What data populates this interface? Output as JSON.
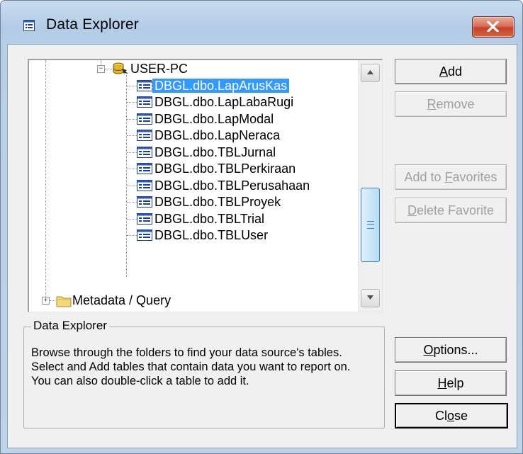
{
  "window": {
    "title": "Data Explorer",
    "close_icon": "close-x-icon",
    "app_icon": "data-explorer-icon"
  },
  "tree": {
    "server": "USER-PC",
    "tables": [
      "DBGL.dbo.LapArusKas",
      "DBGL.dbo.LapLabaRugi",
      "DBGL.dbo.LapModal",
      "DBGL.dbo.LapNeraca",
      "DBGL.dbo.TBLJurnal",
      "DBGL.dbo.TBLPerkiraan",
      "DBGL.dbo.TBLPerusahaan",
      "DBGL.dbo.TBLProyek",
      "DBGL.dbo.TBLTrial",
      "DBGL.dbo.TBLUser"
    ],
    "selected_index": 0,
    "folder": "Metadata / Query"
  },
  "buttons": {
    "add": {
      "pre": "",
      "key": "A",
      "post": "dd"
    },
    "remove": {
      "pre": "",
      "key": "R",
      "post": "emove"
    },
    "add_favorites": {
      "pre": "Add to ",
      "key": "F",
      "post": "avorites"
    },
    "delete_favorite": {
      "pre": "",
      "key": "D",
      "post": "elete Favorite"
    },
    "options": {
      "pre": "",
      "key": "O",
      "post": "ptions..."
    },
    "help": {
      "pre": "",
      "key": "H",
      "post": "elp"
    },
    "close": {
      "pre": "Cl",
      "key": "o",
      "post": "se"
    }
  },
  "info": {
    "title": "Data Explorer",
    "description": "Browse through the folders to find your data source's tables.  Select and Add tables that contain data you want to report on.  You can also double-click a table to add it."
  },
  "colors": {
    "selection": "#3399ff",
    "title_gradient_top": "#c8dbef",
    "close_red": "#c4422a"
  }
}
